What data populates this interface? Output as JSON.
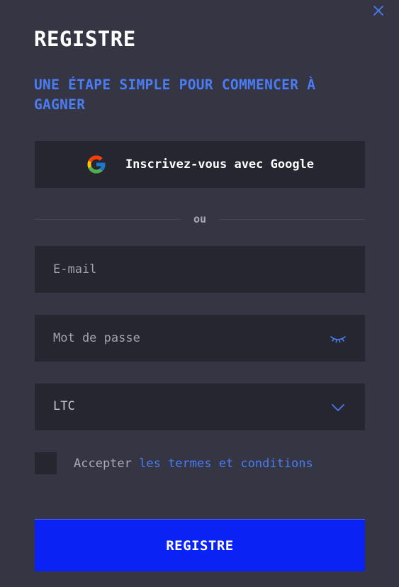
{
  "modal": {
    "title": "REGISTRE",
    "subtitle": "UNE ÉTAPE SIMPLE POUR COMMENCER À GAGNER"
  },
  "google": {
    "label": "Inscrivez-vous avec Google"
  },
  "divider": {
    "text": "ou"
  },
  "form": {
    "email_placeholder": "E-mail",
    "email_value": "",
    "password_placeholder": "Mot de passe",
    "password_value": "",
    "currency_value": "LTC"
  },
  "terms": {
    "prefix": "Accepter ",
    "link_text": "les termes et conditions",
    "checked": false
  },
  "submit": {
    "label": "REGISTRE"
  },
  "icons": {
    "close": "close-icon",
    "google": "google-icon",
    "password_toggle": "eye-closed-icon",
    "currency_dropdown": "chevron-down-icon"
  },
  "colors": {
    "background": "#353544",
    "field_bg": "#262630",
    "accent_blue": "#4a7cf3",
    "submit_bg": "#0b22f5"
  }
}
